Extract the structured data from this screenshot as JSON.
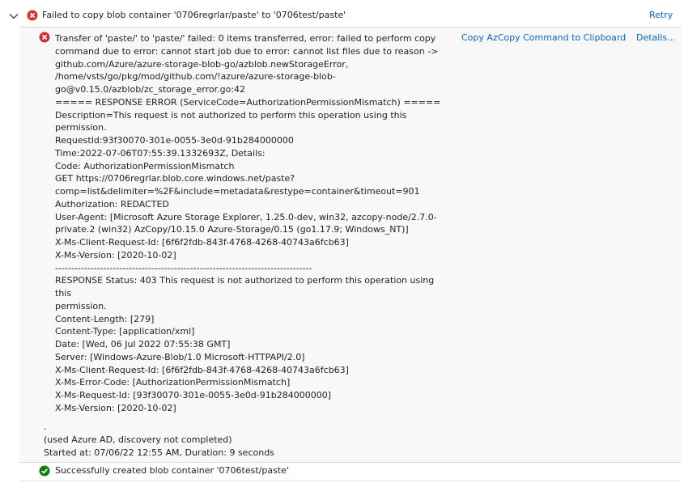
{
  "top_row": {
    "title": "Failed to copy blob container '0706regrlar/paste' to '0706test/paste'",
    "retry_label": "Retry",
    "expand_icon": "chevron-down-icon",
    "status_icon": "error-circle-icon"
  },
  "child_row": {
    "status_icon": "error-circle-icon",
    "copy_label": "Copy AzCopy Command to Clipboard",
    "details_label": "Details...",
    "message": "Transfer of 'paste/' to 'paste/' failed: 0 items transferred, error: failed to perform copy\ncommand due to error: cannot start job due to error: cannot list files due to reason ->\ngithub.com/Azure/azure-storage-blob-go/azblob.newStorageError,\n/home/vsts/go/pkg/mod/github.com/!azure/azure-storage-blob-\ngo@v0.15.0/azblob/zc_storage_error.go:42\n===== RESPONSE ERROR (ServiceCode=AuthorizationPermissionMismatch) =====\nDescription=This request is not authorized to perform this operation using this permission.\nRequestId:93f30070-301e-0055-3e0d-91b284000000\nTime:2022-07-06T07:55:39.1332693Z, Details:\nCode: AuthorizationPermissionMismatch\nGET https://0706regrlar.blob.core.windows.net/paste?\ncomp=list&delimiter=%2F&include=metadata&restype=container&timeout=901\nAuthorization: REDACTED\nUser-Agent: [Microsoft Azure Storage Explorer, 1.25.0-dev, win32, azcopy-node/2.7.0-\nprivate.2 (win32) AzCopy/10.15.0 Azure-Storage/0.15 (go1.17.9; Windows_NT)]\nX-Ms-Client-Request-Id: [6f6f2fdb-843f-4768-4268-40743a6fcb63]\nX-Ms-Version: [2020-10-02]\n--------------------------------------------------------------------------------\nRESPONSE Status: 403 This request is not authorized to perform this operation using this\npermission.\nContent-Length: [279]\nContent-Type: [application/xml]\nDate: [Wed, 06 Jul 2022 07:55:38 GMT]\nServer: [Windows-Azure-Blob/1.0 Microsoft-HTTPAPI/2.0]\nX-Ms-Client-Request-Id: [6f6f2fdb-843f-4768-4268-40743a6fcb63]\nX-Ms-Error-Code: [AuthorizationPermissionMismatch]\nX-Ms-Request-Id: [93f30070-301e-0055-3e0d-91b284000000]\nX-Ms-Version: [2020-10-02]",
    "footer": ".\n(used Azure AD, discovery not completed)\nStarted at: 07/06/22 12:55 AM, Duration: 9 seconds"
  },
  "bottom_row": {
    "status_icon": "success-check-icon",
    "title": "Successfully created blob container '0706test/paste'"
  },
  "colors": {
    "error": "#d13438",
    "success": "#107c10",
    "link": "#0b65b8"
  }
}
